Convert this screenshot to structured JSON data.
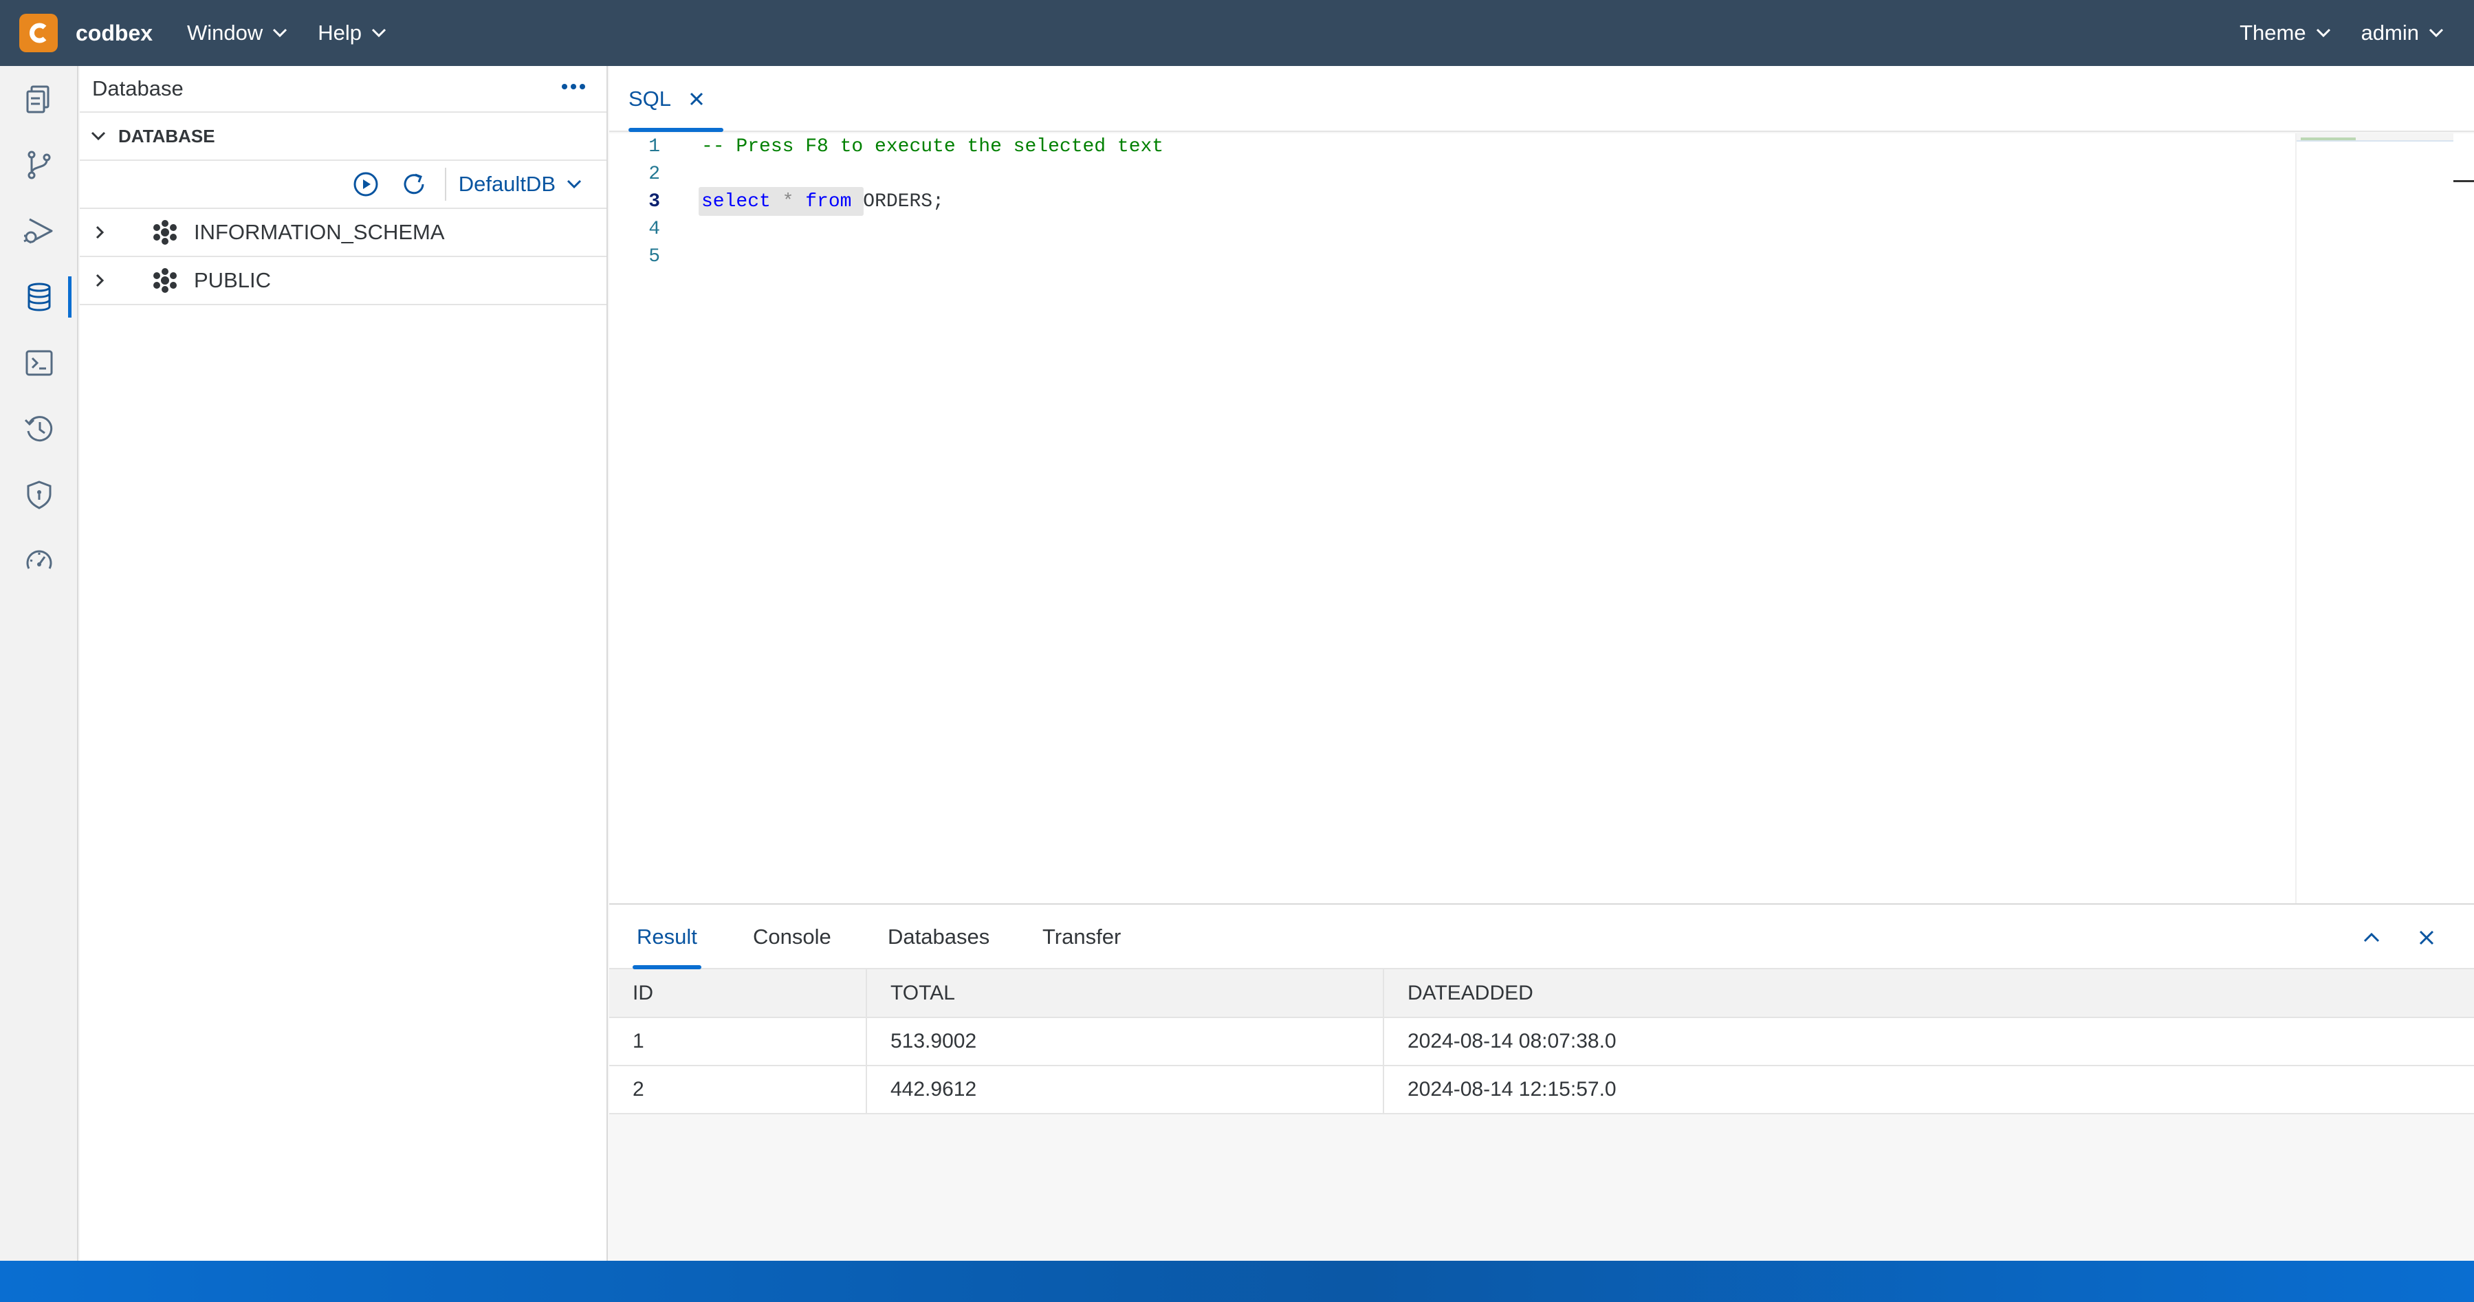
{
  "header": {
    "brand": "codbex",
    "menus": [
      {
        "label": "Window"
      },
      {
        "label": "Help"
      }
    ],
    "theme_label": "Theme",
    "user_label": "admin"
  },
  "activity_bar": {
    "items": [
      {
        "icon": "documents-icon"
      },
      {
        "icon": "git-branch-icon"
      },
      {
        "icon": "debug-run-icon"
      },
      {
        "icon": "database-icon",
        "active": true
      },
      {
        "icon": "terminal-icon"
      },
      {
        "icon": "history-icon"
      },
      {
        "icon": "shield-icon"
      },
      {
        "icon": "speedometer-icon"
      }
    ]
  },
  "explorer": {
    "title": "Database",
    "section": "DATABASE",
    "datasource": "DefaultDB",
    "schemas": [
      {
        "name": "INFORMATION_SCHEMA"
      },
      {
        "name": "PUBLIC"
      }
    ]
  },
  "editor": {
    "tab_label": "SQL",
    "line_numbers": [
      "1",
      "2",
      "3",
      "4",
      "5"
    ],
    "comment": "-- Press F8 to execute the selected text",
    "query": {
      "kw1": "select",
      "star": " * ",
      "kw2": "from",
      "rest": " ORDERS;"
    }
  },
  "panel": {
    "tabs": [
      {
        "label": "Result",
        "active": true
      },
      {
        "label": "Console"
      },
      {
        "label": "Databases"
      },
      {
        "label": "Transfer"
      }
    ]
  },
  "results": {
    "columns": [
      "ID",
      "TOTAL",
      "DATEADDED"
    ],
    "rows": [
      [
        "1",
        "513.9002",
        "2024-08-14 08:07:38.0"
      ],
      [
        "2",
        "442.9612",
        "2024-08-14 12:15:57.0"
      ]
    ]
  },
  "colors": {
    "header_bg": "#354a5f",
    "accent": "#0a6ed1",
    "logo_bg": "#e8871e",
    "statusbar": "#0a6ed1"
  }
}
